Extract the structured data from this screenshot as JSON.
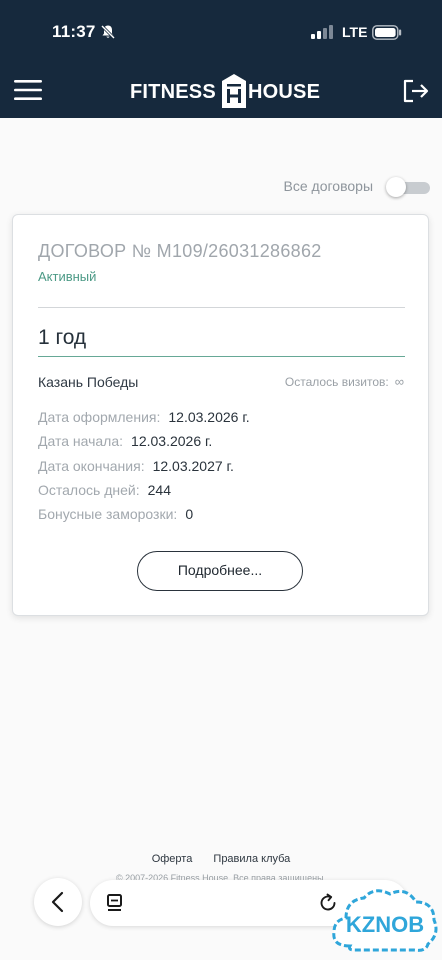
{
  "status_bar": {
    "time": "11:37",
    "network": "LTE",
    "icons": [
      "bell-muted-icon",
      "signal-icon",
      "battery-icon"
    ]
  },
  "header": {
    "logo_left": "FITNESS",
    "logo_right": "HOUSE",
    "icons": [
      "menu-icon",
      "logout-icon"
    ],
    "background": "#16293d"
  },
  "filter": {
    "label": "Все договоры",
    "toggle_on": false
  },
  "contract": {
    "number": "ДОГОВОР № М109/26031286862",
    "status": "Активный",
    "plan": "1 год",
    "club": "Казань Победы",
    "visits_label": "Осталось визитов:",
    "visits_value": "∞",
    "details": [
      {
        "label": "Дата оформления:",
        "value": "12.03.2026 г."
      },
      {
        "label": "Дата начала:",
        "value": "12.03.2026 г."
      },
      {
        "label": "Дата окончания:",
        "value": "12.03.2027 г."
      },
      {
        "label": "Осталось дней:",
        "value": "244"
      },
      {
        "label": "Бонусные заморозки:",
        "value": "0"
      }
    ],
    "more_button": "Подробнее...",
    "status_color": "#4c9a86"
  },
  "footer": {
    "links": [
      "Оферта",
      "Правила клуба"
    ],
    "copyright": "© 2007-2026 Fitness House. Все права защищены."
  },
  "browser": {
    "icons": [
      "back-icon",
      "tabs-icon",
      "reload-icon"
    ]
  },
  "watermark": {
    "text": "KZNOB"
  }
}
